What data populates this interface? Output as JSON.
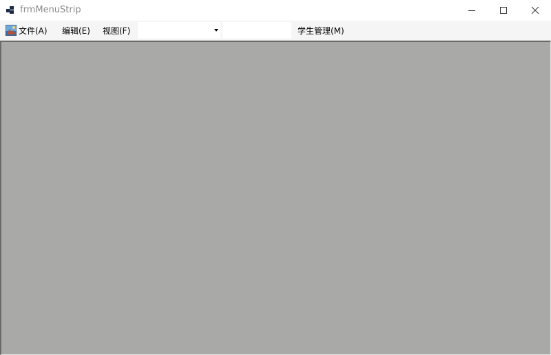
{
  "window": {
    "title": "frmMenuStrip"
  },
  "menu": {
    "file_label": "文件(A)",
    "edit_label": "编辑(E)",
    "view_label": "视图(F)",
    "student_label": "学生管理(M)",
    "combo_value": "",
    "textbox_value": ""
  },
  "icons": {
    "app": "app-form-icon",
    "file": "picture-icon",
    "minimize": "minimize-icon",
    "maximize": "maximize-icon",
    "close": "close-icon"
  },
  "colors": {
    "mdi_background": "#a9a9a7",
    "menustrip_background": "#f5f5f5",
    "title_text": "#8a8a8a"
  }
}
